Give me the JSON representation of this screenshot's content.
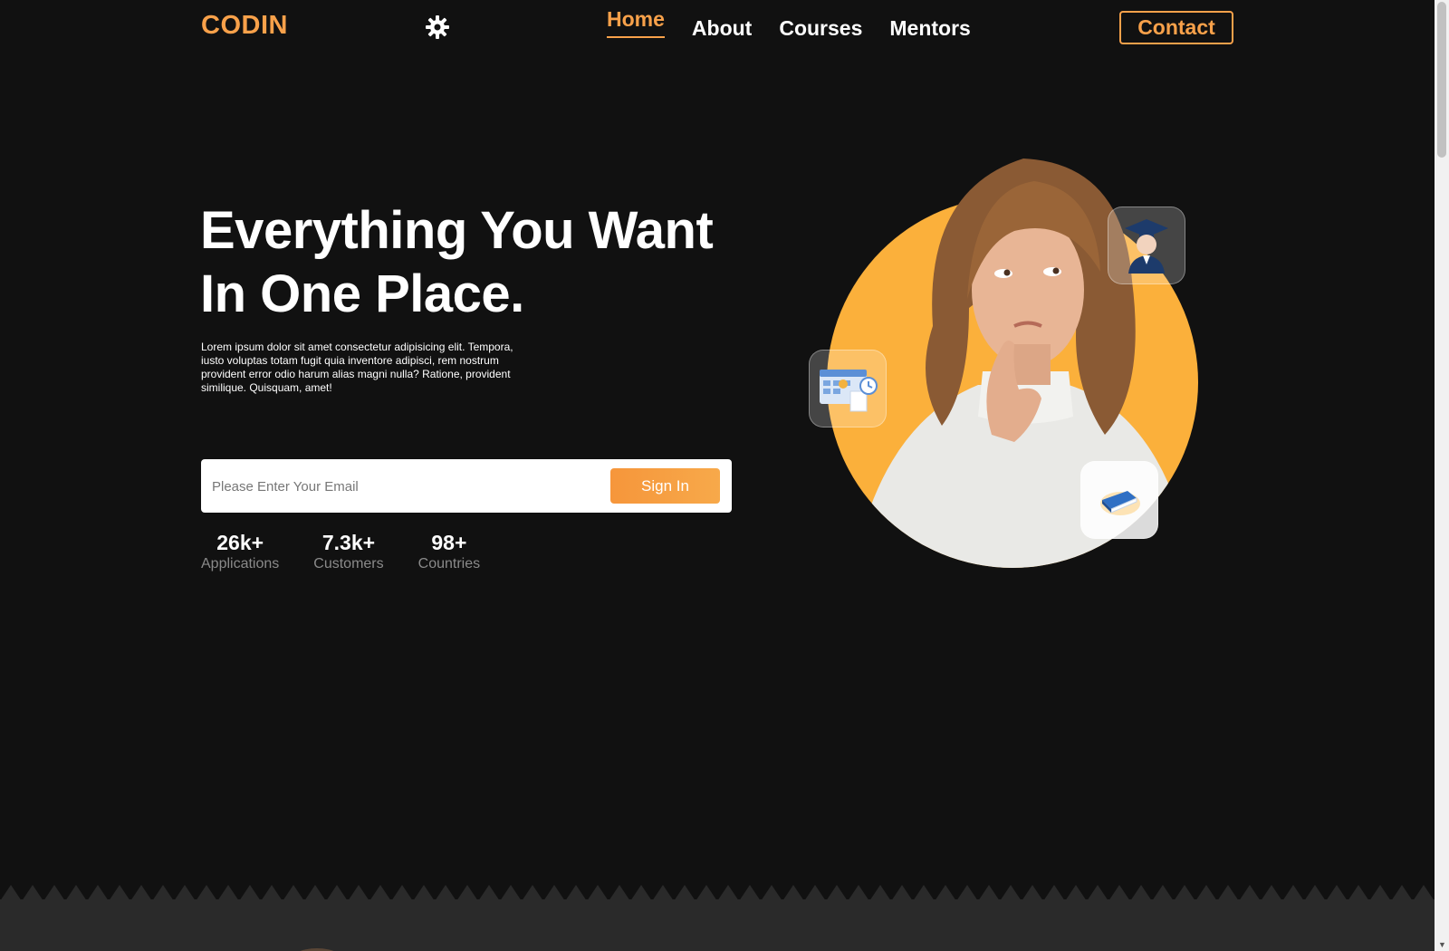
{
  "header": {
    "logo": "CODIN",
    "theme_toggle_icon": "gear-icon",
    "nav": [
      {
        "label": "Home",
        "active": true
      },
      {
        "label": "About",
        "active": false
      },
      {
        "label": "Courses",
        "active": false
      },
      {
        "label": "Mentors",
        "active": false
      }
    ],
    "contact_label": "Contact"
  },
  "hero": {
    "title_line1": "Everything You Want",
    "title_line2": "In One Place.",
    "description": "Lorem ipsum dolor sit amet consectetur adipisicing elit. Tempora, iusto voluptas totam fugit quia inventore adipisci, rem nostrum provident error odio harum alias magni nulla? Ratione, provident similique. Quisquam, amet!",
    "email_placeholder": "Please Enter Your Email",
    "signin_label": "Sign In",
    "stats": [
      {
        "value": "26k+",
        "label": "Applications"
      },
      {
        "value": "7.3k+",
        "label": "Customers"
      },
      {
        "value": "98+",
        "label": "Countries"
      }
    ],
    "floating_icons": [
      "graduate-icon",
      "calendar-icon",
      "book-icon"
    ]
  },
  "colors": {
    "accent": "#f8a14a",
    "background": "#111111",
    "circle": "#fbb03b",
    "band": "#2a2a2a"
  }
}
